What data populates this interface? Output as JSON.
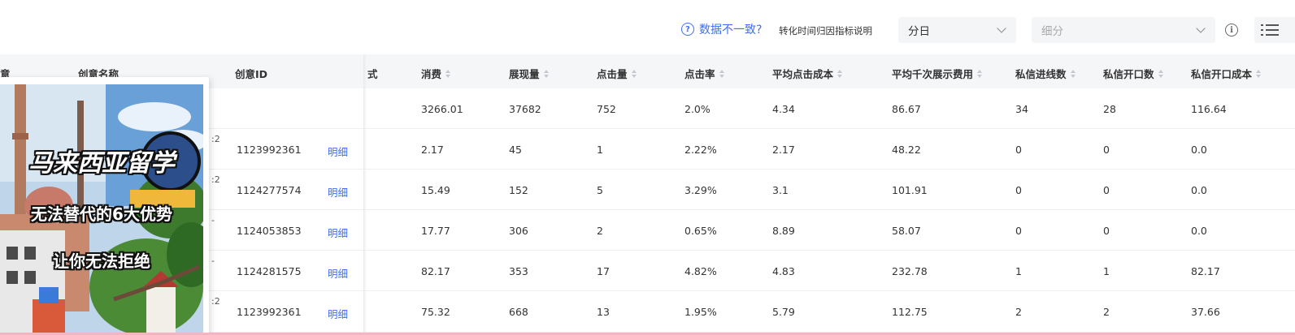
{
  "toolbar": {
    "hint_main": "数据不一致?",
    "hint_sub": "转化时间归因指标说明",
    "granularity_select": "分日",
    "segment_select_placeholder": "细分"
  },
  "columns": {
    "col0_partial": "意",
    "creative_name": "创意名称",
    "creative_id": "创意ID",
    "col_partial": "式",
    "spend": "消费",
    "impressions": "展现量",
    "clicks": "点击量",
    "ctr": "点击率",
    "avg_cpc": "平均点击成本",
    "avg_cpm": "平均千次展示费用",
    "dm_leads": "私信进线数",
    "dm_opens": "私信开口数",
    "dm_open_cost": "私信开口成本"
  },
  "summary_row": {
    "spend": "3266.01",
    "impressions": "37682",
    "clicks": "752",
    "ctr": "2.0%",
    "avg_cpc": "4.34",
    "avg_cpm": "86.67",
    "dm_leads": "34",
    "dm_opens": "28",
    "dm_open_cost": "116.64"
  },
  "rows": [
    {
      "frag": ":2",
      "creative_id": "1123992361",
      "detail": "明细",
      "spend": "2.17",
      "impressions": "45",
      "clicks": "1",
      "ctr": "2.22%",
      "avg_cpc": "2.17",
      "avg_cpm": "48.22",
      "dm_leads": "0",
      "dm_opens": "0",
      "dm_open_cost": "0.0"
    },
    {
      "frag": ":2",
      "creative_id": "1124277574",
      "detail": "明细",
      "spend": "15.49",
      "impressions": "152",
      "clicks": "5",
      "ctr": "3.29%",
      "avg_cpc": "3.1",
      "avg_cpm": "101.91",
      "dm_leads": "0",
      "dm_opens": "0",
      "dm_open_cost": "0.0"
    },
    {
      "frag": "-",
      "creative_id": "1124053853",
      "detail": "明细",
      "spend": "17.77",
      "impressions": "306",
      "clicks": "2",
      "ctr": "0.65%",
      "avg_cpc": "8.89",
      "avg_cpm": "58.07",
      "dm_leads": "0",
      "dm_opens": "0",
      "dm_open_cost": "0.0"
    },
    {
      "frag": "-",
      "creative_id": "1124281575",
      "detail": "明细",
      "spend": "82.17",
      "impressions": "353",
      "clicks": "17",
      "ctr": "4.82%",
      "avg_cpc": "4.83",
      "avg_cpm": "232.78",
      "dm_leads": "1",
      "dm_opens": "1",
      "dm_open_cost": "82.17"
    },
    {
      "frag": ":2",
      "creative_id": "1123992361",
      "detail": "明细",
      "spend": "75.32",
      "impressions": "668",
      "clicks": "13",
      "ctr": "1.95%",
      "avg_cpc": "5.79",
      "avg_cpm": "112.75",
      "dm_leads": "2",
      "dm_opens": "2",
      "dm_open_cost": "37.66"
    }
  ],
  "thumbnail": {
    "line1": "马来西亚留学",
    "line2": "无法替代的6大优势",
    "line3": "让你无法拒绝"
  }
}
